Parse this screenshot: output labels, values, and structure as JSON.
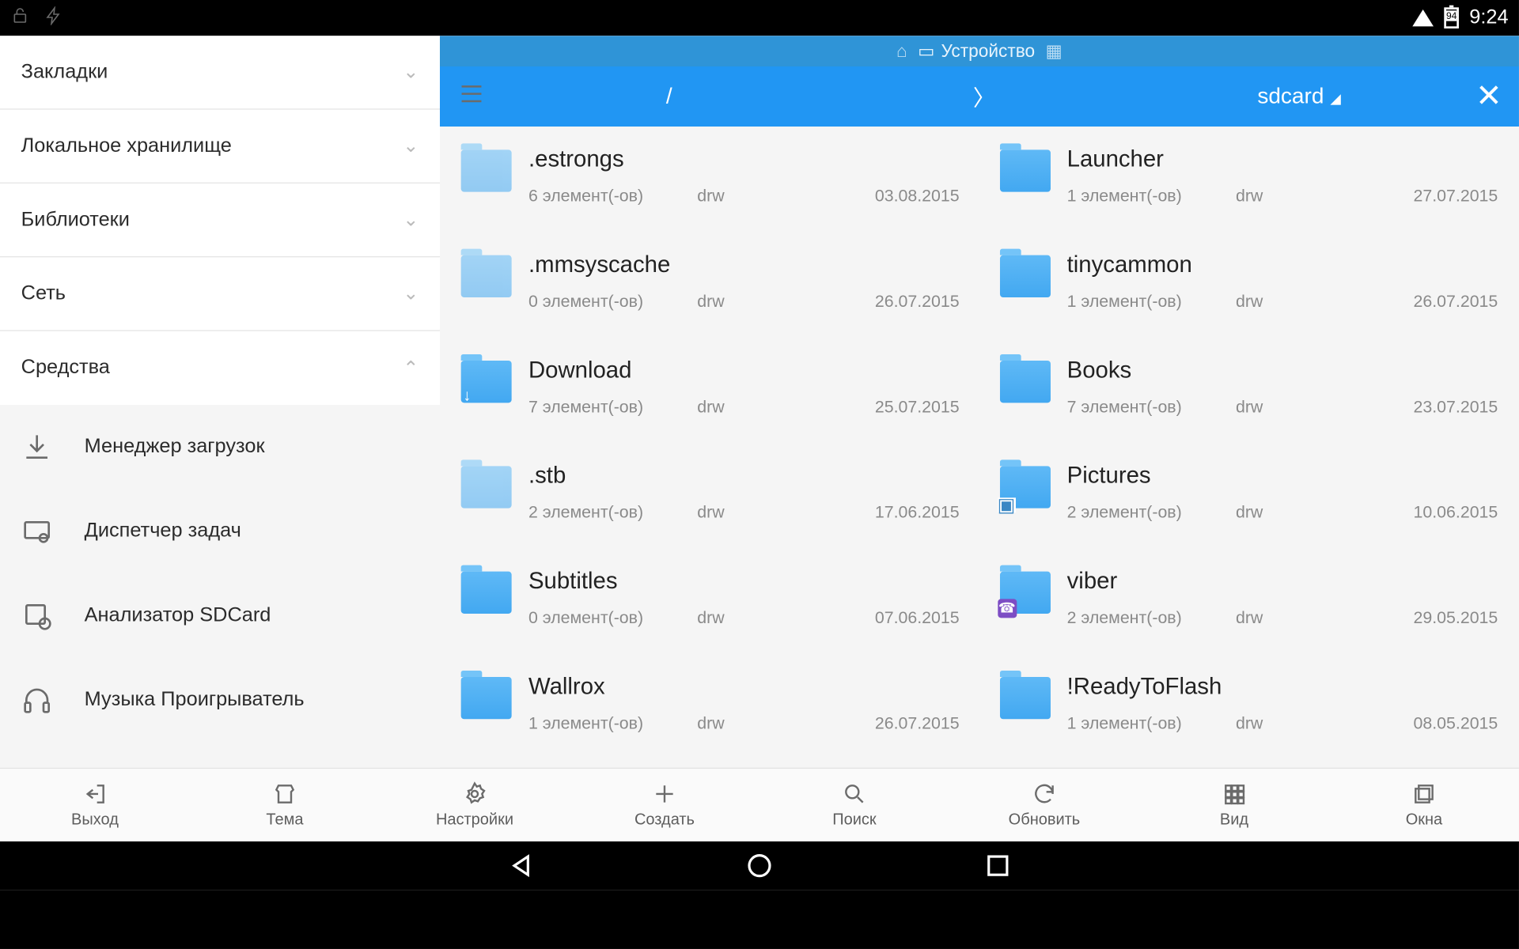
{
  "statusbar": {
    "battery": "94",
    "clock": "9:24"
  },
  "sidebar": {
    "sections": [
      {
        "label": "Закладки"
      },
      {
        "label": "Локальное хранилище"
      },
      {
        "label": "Библиотеки"
      },
      {
        "label": "Сеть"
      },
      {
        "label": "Средства"
      }
    ],
    "tools": [
      {
        "label": "Менеджер загрузок"
      },
      {
        "label": "Диспетчер задач"
      },
      {
        "label": "Анализатор SDCard"
      },
      {
        "label": "Музыка Проигрыватель"
      }
    ]
  },
  "crumb": {
    "device_label": "Устройство"
  },
  "path": {
    "segments": [
      "/",
      "〉",
      "sdcard"
    ]
  },
  "files_left": [
    {
      "name": ".estrongs",
      "count": "6 элемент(-ов)",
      "perm": "drw",
      "date": "03.08.2015",
      "cls": "faded"
    },
    {
      "name": ".mmsyscache",
      "count": "0 элемент(-ов)",
      "perm": "drw",
      "date": "26.07.2015",
      "cls": "faded"
    },
    {
      "name": "Download",
      "count": "7 элемент(-ов)",
      "perm": "drw",
      "date": "25.07.2015",
      "cls": "dl"
    },
    {
      "name": ".stb",
      "count": "2 элемент(-ов)",
      "perm": "drw",
      "date": "17.06.2015",
      "cls": "faded"
    },
    {
      "name": "Subtitles",
      "count": "0 элемент(-ов)",
      "perm": "drw",
      "date": "07.06.2015",
      "cls": ""
    },
    {
      "name": "Wallrox",
      "count": "1 элемент(-ов)",
      "perm": "drw",
      "date": "26.07.2015",
      "cls": ""
    }
  ],
  "files_right": [
    {
      "name": "Launcher",
      "count": "1 элемент(-ов)",
      "perm": "drw",
      "date": "27.07.2015",
      "cls": ""
    },
    {
      "name": "tinycammon",
      "count": "1 элемент(-ов)",
      "perm": "drw",
      "date": "26.07.2015",
      "cls": ""
    },
    {
      "name": "Books",
      "count": "7 элемент(-ов)",
      "perm": "drw",
      "date": "23.07.2015",
      "cls": ""
    },
    {
      "name": "Pictures",
      "count": "2 элемент(-ов)",
      "perm": "drw",
      "date": "10.06.2015",
      "cls": "pic"
    },
    {
      "name": "viber",
      "count": "2 элемент(-ов)",
      "perm": "drw",
      "date": "29.05.2015",
      "cls": "vib"
    },
    {
      "name": "!ReadyToFlash",
      "count": "1 элемент(-ов)",
      "perm": "drw",
      "date": "08.05.2015",
      "cls": ""
    }
  ],
  "appbar": [
    {
      "label": "Выход"
    },
    {
      "label": "Тема"
    },
    {
      "label": "Настройки"
    },
    {
      "label": "Создать"
    },
    {
      "label": "Поиск"
    },
    {
      "label": "Обновить"
    },
    {
      "label": "Вид"
    },
    {
      "label": "Окна"
    }
  ]
}
